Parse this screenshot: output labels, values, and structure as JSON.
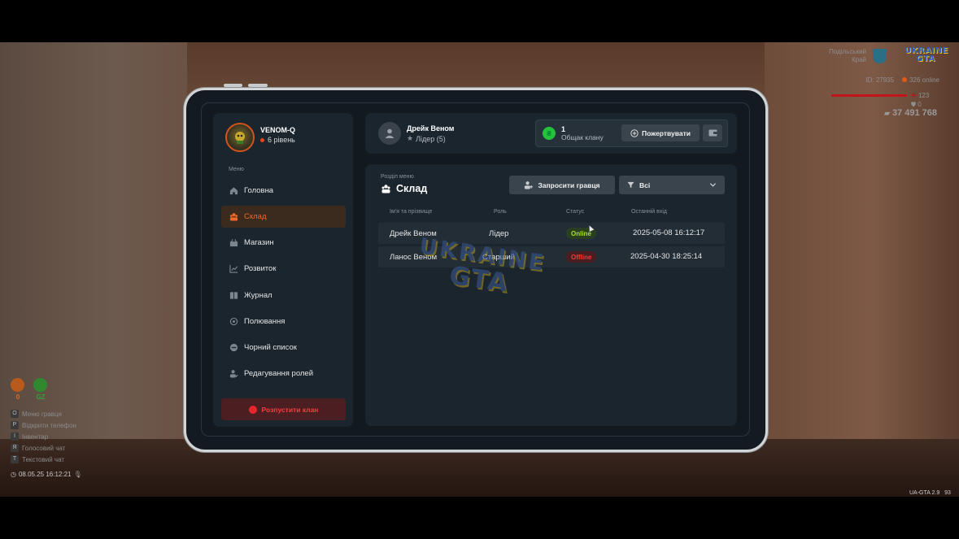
{
  "hud": {
    "region_line1": "Подільський",
    "region_line2": "Край",
    "logo_line1": "UKRAINE",
    "logo_line2": "GTA",
    "player_id": "ID: 27935",
    "online": "326 online",
    "health": "123",
    "armor": "0",
    "money": "37 491 768",
    "badge_left": "0",
    "badge_right": "GZ",
    "keys": [
      {
        "key": "O",
        "label": "Меню гравця"
      },
      {
        "key": "P",
        "label": "Відкрити телефон"
      },
      {
        "key": "I",
        "label": "Інвентар"
      },
      {
        "key": "Я",
        "label": "Голосовий чат"
      },
      {
        "key": "T",
        "label": "Текстовий чат"
      }
    ],
    "datetime": "08.05.25 16:12:21",
    "version": "UA-GTA 2.9",
    "fps": "93"
  },
  "profile": {
    "name": "VENOM-Q",
    "level": "6 рівень"
  },
  "menu": {
    "caption": "Меню",
    "items": [
      {
        "label": "Головна",
        "icon": "home-icon"
      },
      {
        "label": "Склад",
        "icon": "members-icon"
      },
      {
        "label": "Магазин",
        "icon": "shop-icon"
      },
      {
        "label": "Розвиток",
        "icon": "chart-icon"
      },
      {
        "label": "Журнал",
        "icon": "book-icon"
      },
      {
        "label": "Полювання",
        "icon": "target-icon"
      },
      {
        "label": "Чорний список",
        "icon": "block-icon"
      },
      {
        "label": "Редагування ролей",
        "icon": "user-edit-icon"
      }
    ],
    "disband": "Розпустити клан"
  },
  "leader": {
    "name": "Дрейк Веном",
    "role": "Лідер (5)"
  },
  "clan": {
    "count": "1",
    "label": "Общак клану",
    "donate": "Пожертвувати"
  },
  "section": {
    "caption": "Розділ меню",
    "title": "Склад",
    "invite": "Запросити гравця",
    "filter": "Всі"
  },
  "table": {
    "headers": [
      "Ім'я та прізвище",
      "Роль",
      "Статус",
      "Останній вхід"
    ],
    "rows": [
      {
        "name": "Дрейк Веном",
        "role": "Лідер",
        "status": "Online",
        "last": "2025-05-08 16:12:17"
      },
      {
        "name": "Ланос Веном",
        "role": "Старший",
        "status": "Offline",
        "last": "2025-04-30 18:25:14"
      }
    ]
  },
  "watermark": {
    "line1": "UKRAINE",
    "line2": "GTA"
  },
  "colors": {
    "accent": "#ee6a2a",
    "online": "#a6e21c",
    "offline": "#ef3b3b",
    "panel": "#1b252d"
  }
}
